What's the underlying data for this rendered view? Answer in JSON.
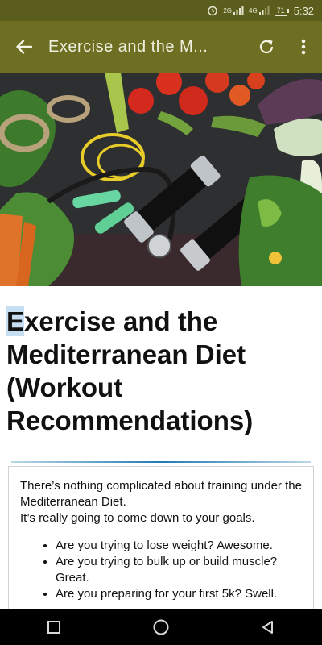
{
  "status_bar": {
    "time": "5:32",
    "battery": "71",
    "signal_1_label": "2G",
    "signal_2_label": "4G"
  },
  "app_bar": {
    "title": "Exercise and the M..."
  },
  "hero": {
    "icon": "hero-photo"
  },
  "article": {
    "title_first_letter": "E",
    "title_rest": "xercise and the Mediterranean Diet (Workout Recommendations)",
    "intro_line_1": "There’s nothing complicated about training under the Mediterranean Diet.",
    "intro_line_2": "It’s really going to come down to your goals.",
    "bullets": [
      "Are you trying to lose weight? Awesome.",
      "Are you trying to bulk up or build muscle? Great.",
      "Are you preparing for your first 5k? Swell."
    ]
  },
  "colors": {
    "status_bar": "#5b5d1c",
    "app_bar": "#6e6f22",
    "divider_accent": "#1f7ab0"
  },
  "nav_bar": {
    "recents_icon": "square-icon",
    "home_icon": "circle-icon",
    "back_icon": "triangle-icon"
  }
}
